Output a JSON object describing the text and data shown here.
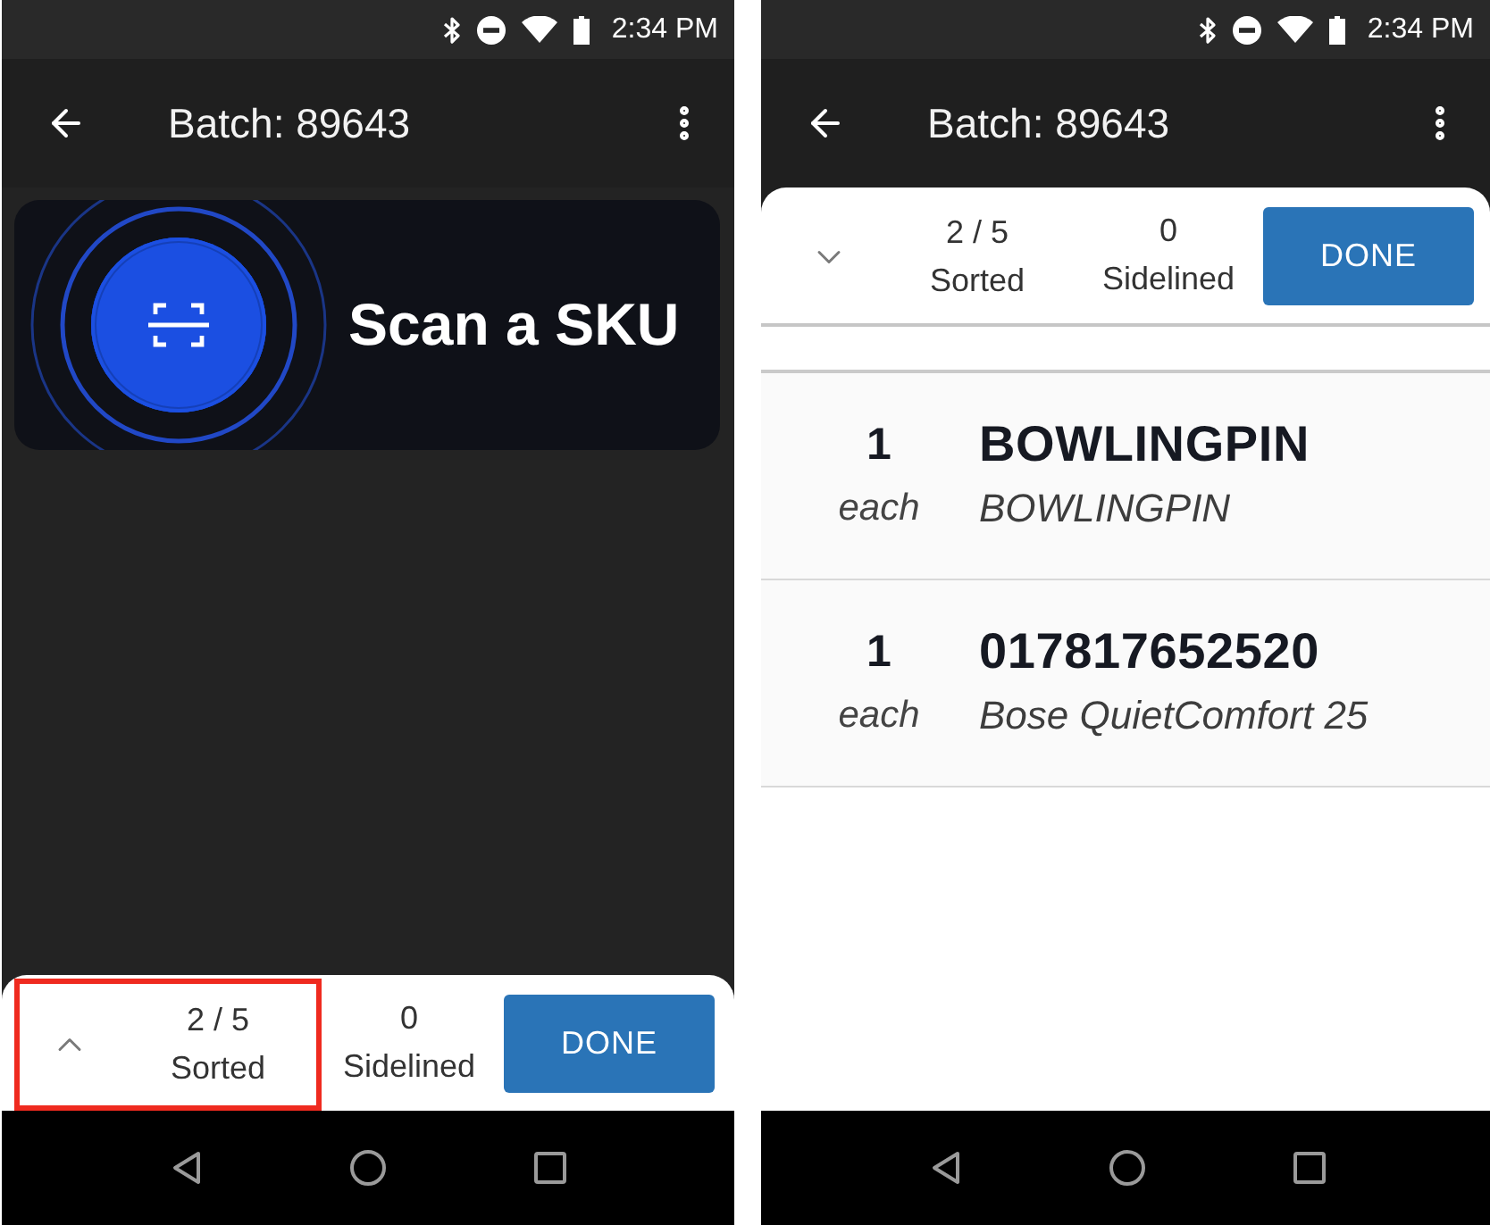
{
  "screens": [
    {
      "status_bar": {
        "time": "2:34 PM"
      },
      "app_bar": {
        "title": "Batch: 89643"
      },
      "scan_card": {
        "label": "Scan a SKU"
      },
      "summary": {
        "expanded": false,
        "highlighted": true,
        "sorted": {
          "value": "2 / 5",
          "label": "Sorted"
        },
        "sidelined": {
          "value": "0",
          "label": "Sidelined"
        },
        "button": "DONE"
      }
    },
    {
      "status_bar": {
        "time": "2:34 PM"
      },
      "app_bar": {
        "title": "Batch: 89643"
      },
      "summary": {
        "expanded": true,
        "highlighted": false,
        "sorted": {
          "value": "2 / 5",
          "label": "Sorted"
        },
        "sidelined": {
          "value": "0",
          "label": "Sidelined"
        },
        "button": "DONE"
      },
      "items": [
        {
          "quantity": "1",
          "unit": "each",
          "sku": "BOWLINGPIN",
          "name": "BOWLINGPIN"
        },
        {
          "quantity": "1",
          "unit": "each",
          "sku": "017817652520",
          "name": "Bose QuietComfort 25"
        }
      ]
    }
  ]
}
